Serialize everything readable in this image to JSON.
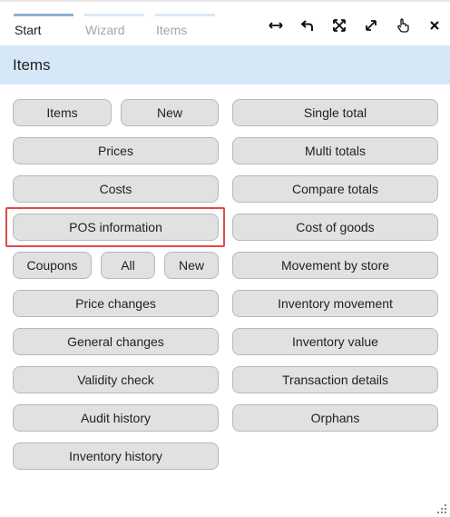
{
  "tabs": [
    {
      "label": "Start",
      "active": true
    },
    {
      "label": "Wizard",
      "active": false
    },
    {
      "label": "Items",
      "active": false
    }
  ],
  "toolbar": {
    "icons": [
      "resize-horizontal-icon",
      "undo-arrow-icon",
      "expand-icon",
      "maximize-diagonal-icon",
      "pointer-hand-icon",
      "close-icon"
    ]
  },
  "section": {
    "title": "Items"
  },
  "left_column": {
    "row1": [
      "Items",
      "New"
    ],
    "prices": "Prices",
    "costs": "Costs",
    "pos_information": "POS information",
    "row5": [
      "Coupons",
      "All",
      "New"
    ],
    "price_changes": "Price changes",
    "general_changes": "General changes",
    "validity_check": "Validity check",
    "audit_history": "Audit history",
    "inventory_history": "Inventory history"
  },
  "right_column": [
    "Single total",
    "Multi totals",
    "Compare totals",
    "Cost of goods",
    "Movement by store",
    "Inventory movement",
    "Inventory value",
    "Transaction details",
    "Orphans"
  ],
  "colors": {
    "header_bg": "#d6e8f8",
    "button_bg": "#e1e1e1",
    "highlight": "#e04a4a",
    "tab_active": "#8fb0d3",
    "tab_inactive": "#dbe8f5"
  }
}
